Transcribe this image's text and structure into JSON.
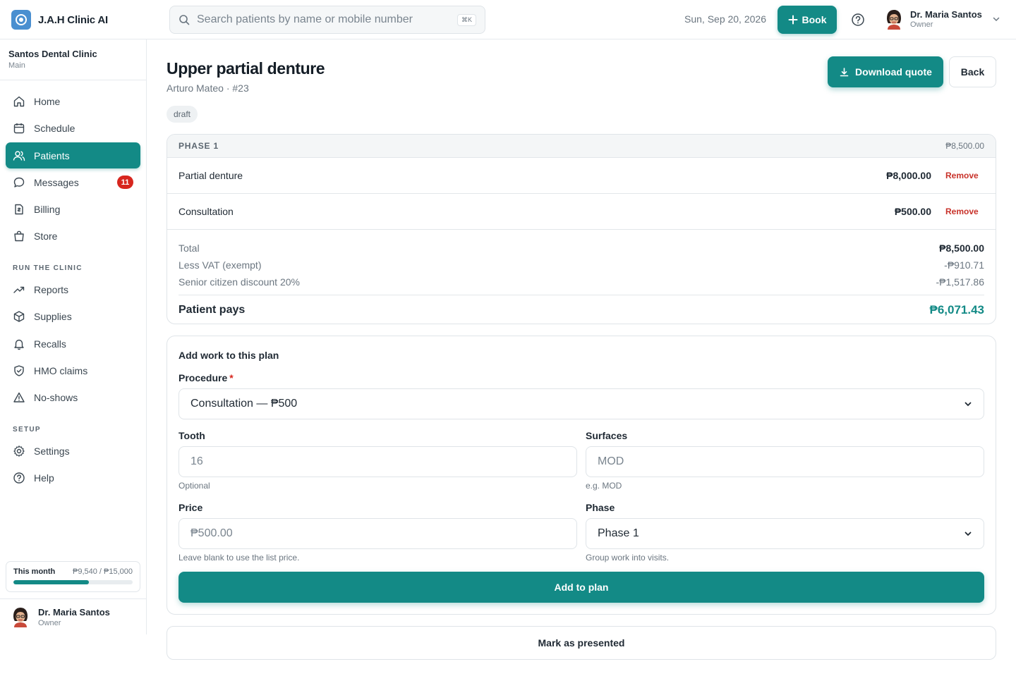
{
  "app": {
    "name": "J.A.H Clinic AI"
  },
  "header": {
    "search_placeholder": "Search patients by name or mobile number",
    "shortcut": "⌘K",
    "date": "Sun, Sep 20, 2026",
    "book_label": "Book",
    "user_name": "Dr. Maria Santos",
    "user_role": "Owner"
  },
  "sidebar": {
    "clinic_name": "Santos Dental Clinic",
    "branch": "Main",
    "items": [
      {
        "label": "Home",
        "icon": "home-icon"
      },
      {
        "label": "Schedule",
        "icon": "calendar-icon"
      },
      {
        "label": "Patients",
        "icon": "users-icon",
        "active": true
      },
      {
        "label": "Messages",
        "icon": "chat-icon",
        "badge": "11"
      },
      {
        "label": "Billing",
        "icon": "receipt-icon"
      },
      {
        "label": "Store",
        "icon": "bag-icon"
      }
    ],
    "section_run": "RUN THE CLINIC",
    "run_items": [
      {
        "label": "Reports",
        "icon": "trend-icon"
      },
      {
        "label": "Supplies",
        "icon": "box-icon"
      },
      {
        "label": "Recalls",
        "icon": "bell-icon"
      },
      {
        "label": "HMO claims",
        "icon": "shield-icon"
      },
      {
        "label": "No-shows",
        "icon": "warning-icon"
      }
    ],
    "section_setup": "SETUP",
    "setup_items": [
      {
        "label": "Settings",
        "icon": "gear-icon"
      },
      {
        "label": "Help",
        "icon": "help-icon"
      }
    ],
    "month": {
      "label": "This month",
      "value": "₱9,540 / ₱15,000",
      "progress": 0.636
    },
    "user_name": "Dr. Maria Santos",
    "user_role": "Owner"
  },
  "plan": {
    "title": "Upper partial denture",
    "subtitle": "Arturo Mateo · #23",
    "status": "draft",
    "download_label": "Download quote",
    "back_label": "Back",
    "phase_label": "PHASE 1",
    "phase_total": "₱8,500.00",
    "items": [
      {
        "name": "Partial denture",
        "price": "₱8,000.00",
        "action": "Remove"
      },
      {
        "name": "Consultation",
        "price": "₱500.00",
        "action": "Remove"
      }
    ],
    "totals": {
      "total_label": "Total",
      "total_value": "₱8,500.00",
      "vat_label": "Less VAT (exempt)",
      "vat_value": "-₱910.71",
      "discount_label": "Senior citizen discount 20%",
      "discount_value": "-₱1,517.86",
      "pays_label": "Patient pays",
      "pays_value": "₱6,071.43"
    }
  },
  "form": {
    "title": "Add work to this plan",
    "procedure_label": "Procedure",
    "procedure_required": "*",
    "procedure_value": "Consultation — ₱500",
    "tooth_label": "Tooth",
    "tooth_placeholder": "16",
    "tooth_hint": "Optional",
    "surfaces_label": "Surfaces",
    "surfaces_placeholder": "MOD",
    "surfaces_hint": "e.g. MOD",
    "price_label": "Price",
    "price_placeholder": "₱500.00",
    "price_hint": "Leave blank to use the list price.",
    "phase_label": "Phase",
    "phase_value": "Phase 1",
    "phase_hint": "Group work into visits.",
    "submit_label": "Add to plan"
  },
  "footer": {
    "mark_label": "Mark as presented"
  },
  "colors": {
    "accent": "#138a86",
    "danger": "#c8322a",
    "badge": "#d7261e"
  }
}
